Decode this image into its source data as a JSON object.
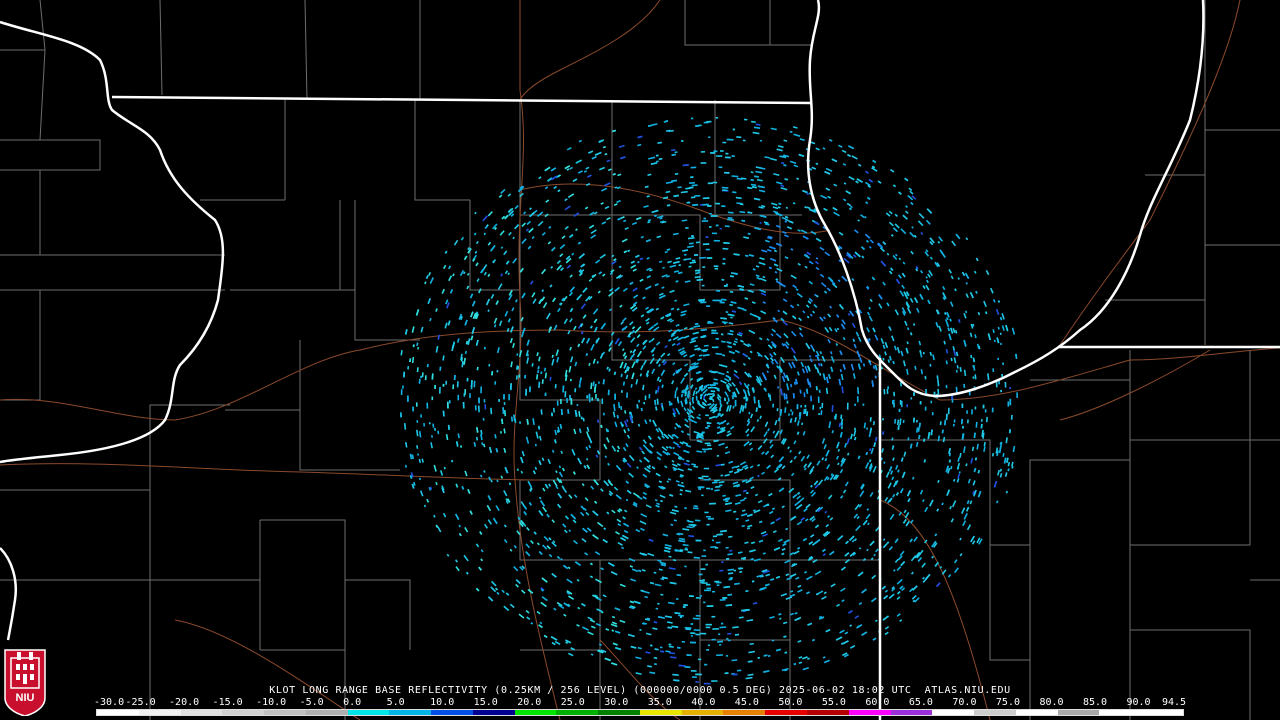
{
  "product": {
    "caption": "KLOT LONG RANGE BASE REFLECTIVITY (0.25KM / 256 LEVEL) (000000/0000 0.5 DEG) 2025-06-02 18:02 UTC  ATLAS.NIU.EDU"
  },
  "legend": {
    "labels": [
      "-30.0",
      "-25.0",
      "-20.0",
      "-15.0",
      "-10.0",
      "-5.0",
      "0.0",
      "5.0",
      "10.0",
      "15.0",
      "20.0",
      "25.0",
      "30.0",
      "35.0",
      "40.0",
      "45.0",
      "50.0",
      "55.0",
      "60.0",
      "65.0",
      "70.0",
      "75.0",
      "80.0",
      "85.0",
      "90.0",
      "94.5"
    ],
    "colors": [
      "#ffffff",
      "#f0f0f0",
      "#e0e0e0",
      "#d0d0d0",
      "#c0c0c0",
      "#b0b0b0",
      "#00e5e5",
      "#00b4e6",
      "#0050e6",
      "#000090",
      "#00e400",
      "#00b000",
      "#008000",
      "#e6e600",
      "#e6b000",
      "#e68000",
      "#e60000",
      "#b40000",
      "#ff00ff",
      "#9b2fd8",
      "#ffffff",
      "#cccccc",
      "#ffffff",
      "#aaaaaa",
      "#ffffff",
      "#ffffff"
    ]
  },
  "logo": {
    "text": "NIU",
    "color": "#c8102e"
  },
  "map": {
    "state_border_color": "#ffffff",
    "county_line_color": "#7a7a7a",
    "highway_color": "#8b4a2b",
    "echo_colors": [
      "#1ec8e6",
      "#10b0e0",
      "#1a8cf0",
      "#2050e0",
      "#30e0e0"
    ]
  }
}
